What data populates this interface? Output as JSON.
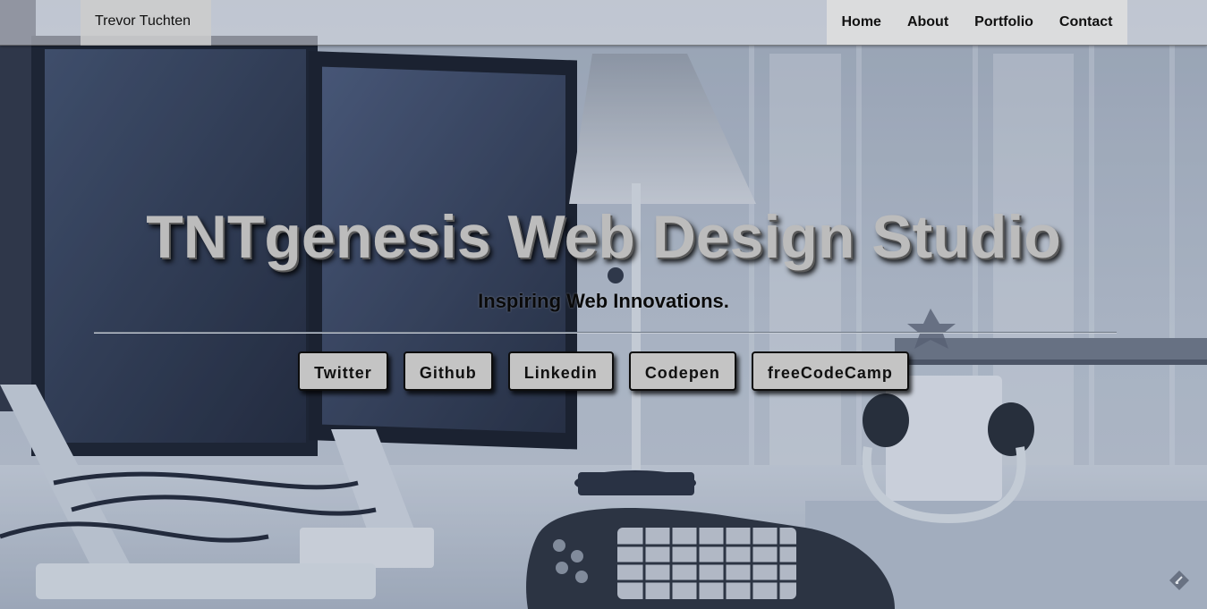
{
  "navbar": {
    "brand": "Trevor Tuchten",
    "links": [
      {
        "label": "Home"
      },
      {
        "label": "About"
      },
      {
        "label": "Portfolio"
      },
      {
        "label": "Contact"
      }
    ]
  },
  "hero": {
    "title": "TNTgenesis Web Design Studio",
    "subtitle": "Inspiring Web Innovations."
  },
  "social": [
    {
      "label": "Twitter"
    },
    {
      "label": "Github"
    },
    {
      "label": "Linkedin"
    },
    {
      "label": "Codepen"
    },
    {
      "label": "freeCodeCamp"
    }
  ],
  "background": {
    "description_icon": "office-desk-background",
    "tint": "#4a5a78"
  },
  "corner": {
    "icon": "edit-icon"
  }
}
